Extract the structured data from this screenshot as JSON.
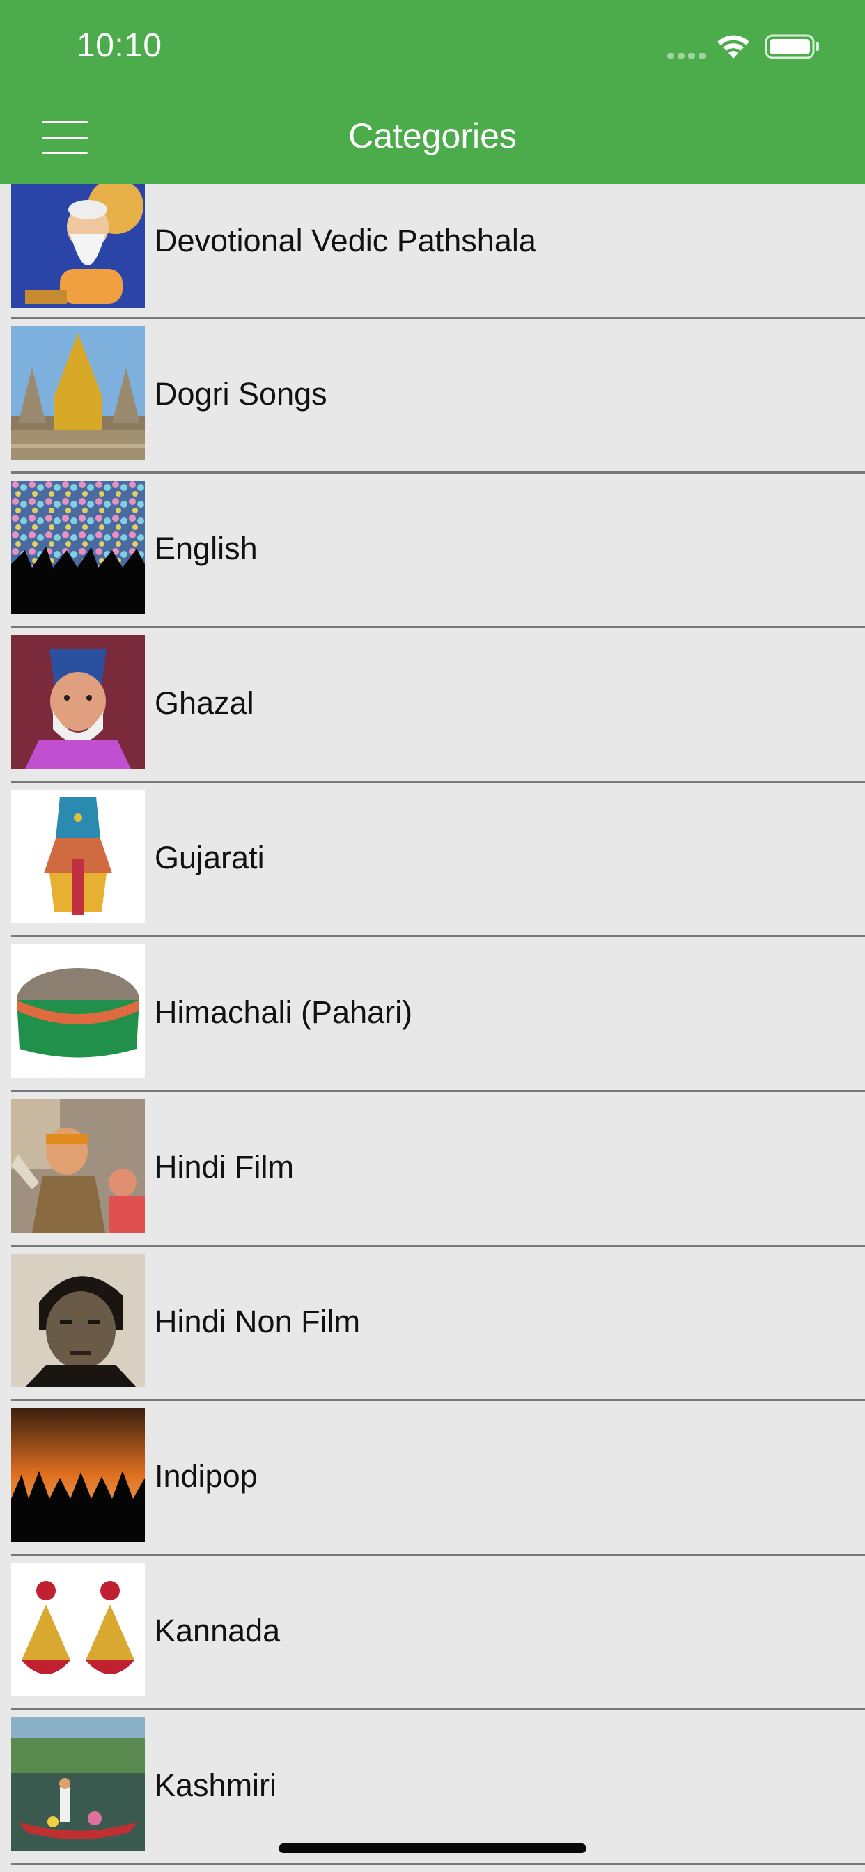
{
  "status_bar": {
    "time": "10:10"
  },
  "nav": {
    "title": "Categories",
    "menu_icon": "hamburger-menu-icon",
    "bar_color": "#4cac4c"
  },
  "categories": [
    {
      "label": "Devotional Vedic Pathshala",
      "image": "sage-portrait-image"
    },
    {
      "label": "Dogri Songs",
      "image": "golden-temple-image"
    },
    {
      "label": "English",
      "image": "concert-crowd-image"
    },
    {
      "label": "Ghazal",
      "image": "poet-portrait-image"
    },
    {
      "label": "Gujarati",
      "image": "traditional-dress-image"
    },
    {
      "label": "Himachali (Pahari)",
      "image": "pahari-cap-image"
    },
    {
      "label": "Hindi Film",
      "image": "film-dance-image"
    },
    {
      "label": "Hindi Non Film",
      "image": "vintage-singer-portrait-image"
    },
    {
      "label": "Indipop",
      "image": "concert-silhouette-image"
    },
    {
      "label": "Kannada",
      "image": "jhumka-earrings-image"
    },
    {
      "label": "Kashmiri",
      "image": "shikara-boat-image"
    }
  ]
}
